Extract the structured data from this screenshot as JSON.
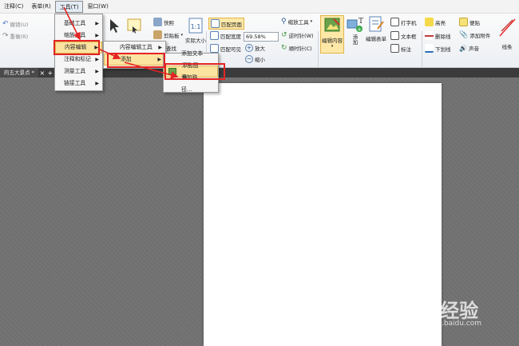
{
  "menubar": [
    "注释(C)",
    "表单(R)",
    "工具(T)",
    "窗口(W)"
  ],
  "menubar_active": "工具(T)",
  "quick": {
    "undo": "撤销(U)",
    "redo": "重做(R)"
  },
  "ribbon": {
    "snapshot": "快照",
    "clipboard": "剪贴板",
    "find": "查找",
    "actual_size": "实际大小",
    "fit_page": "匹配页面",
    "fit_width": "匹配宽度",
    "fit_visible": "匹配可见",
    "zoom_value": "69.58%",
    "zoom_tool": "缩放工具",
    "rotate_ccw": "逆时针(W)",
    "rotate_cw": "顺时针(C)",
    "zoom_in": "放大",
    "zoom_out": "缩小",
    "edit_content": "编辑内容",
    "add": "添加",
    "edit_form": "编辑表单",
    "typewriter": "打字机",
    "textbox": "文本框",
    "callout": "标注",
    "highlight": "高亮",
    "strikeout": "删除线",
    "underline": "下划线",
    "note": "便贴",
    "attach": "添加附件",
    "sound": "声音",
    "line": "线条"
  },
  "tab": {
    "name": "的五大景点 *"
  },
  "tools_menu": [
    "基础工具",
    "缩放工具",
    "内容编辑",
    "注释和标记",
    "测量工具",
    "链接工具"
  ],
  "content_edit_menu": [
    "内容编辑工具",
    "添加"
  ],
  "add_menu": [
    "添加文本工具",
    "添加图像...",
    "添加路径..."
  ],
  "watermark": {
    "main": "Bai 经验",
    "sub": "jingyan.baidu.com"
  },
  "colors": {
    "highlight": "#fbe3a0",
    "annotation": "#e32424"
  }
}
